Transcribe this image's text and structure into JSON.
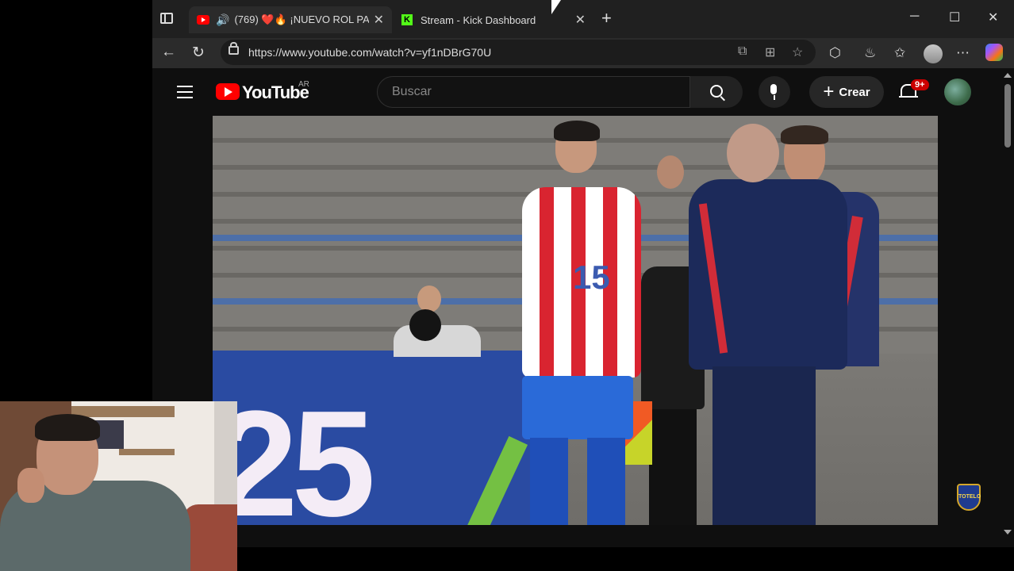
{
  "browser": {
    "tabs": [
      {
        "title": "(769) ❤️🔥 ¡NUEVO ROL PA",
        "active": true
      },
      {
        "title": "Stream - Kick Dashboard",
        "active": false
      }
    ],
    "new_tab": "+",
    "window_controls": {
      "minimize": "─",
      "maximize": "☐",
      "close": "✕"
    },
    "nav": {
      "back": "←",
      "reload": "↻"
    },
    "url": "https://www.youtube.com/watch?v=yf1nDBrG70U",
    "menu": "⋯"
  },
  "youtube": {
    "logo_text": "YouTube",
    "country": "AR",
    "search_placeholder": "Buscar",
    "create_label": "Crear",
    "notifications_badge": "9+"
  },
  "video": {
    "banner_text": "25",
    "jersey_number": "15",
    "channel_watermark": "TOTELO"
  },
  "colors": {
    "youtube_red": "#ff0000",
    "background": "#0f0f0f",
    "kick_green": "#53fc18"
  }
}
